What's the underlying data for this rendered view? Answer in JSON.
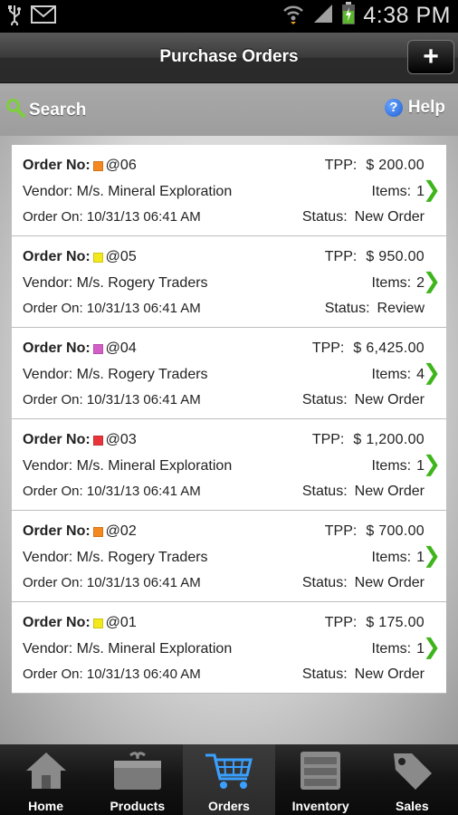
{
  "status_bar": {
    "time": "4:38 PM"
  },
  "header": {
    "title": "Purchase Orders",
    "add_label": "+"
  },
  "toolbar": {
    "search_label": "Search",
    "help_label": "Help"
  },
  "labels": {
    "order_no": "Order No:",
    "vendor": "Vendor:",
    "order_on": "Order On:",
    "tpp": "TPP:",
    "items": "Items:",
    "status": "Status:"
  },
  "orders": [
    {
      "color": "#f5891f",
      "number": "@06",
      "vendor": "M/s. Mineral Exploration",
      "date": "10/31/13 06:41 AM",
      "amount": "$ 200.00",
      "items": "1",
      "status": "New Order"
    },
    {
      "color": "#f2e81c",
      "number": "@05",
      "vendor": "M/s. Rogery Traders",
      "date": "10/31/13 06:41 AM",
      "amount": "$ 950.00",
      "items": "2",
      "status": "Review"
    },
    {
      "color": "#d35fc6",
      "number": "@04",
      "vendor": "M/s. Rogery Traders",
      "date": "10/31/13 06:41 AM",
      "amount": "$ 6,425.00",
      "items": "4",
      "status": "New Order"
    },
    {
      "color": "#e8353a",
      "number": "@03",
      "vendor": "M/s. Mineral Exploration",
      "date": "10/31/13 06:41 AM",
      "amount": "$ 1,200.00",
      "items": "1",
      "status": "New Order"
    },
    {
      "color": "#f5891f",
      "number": "@02",
      "vendor": "M/s. Rogery Traders",
      "date": "10/31/13 06:41 AM",
      "amount": "$ 700.00",
      "items": "1",
      "status": "New Order"
    },
    {
      "color": "#f2e81c",
      "number": "@01",
      "vendor": "M/s. Mineral Exploration",
      "date": "10/31/13 06:40 AM",
      "amount": "$ 175.00",
      "items": "1",
      "status": "New Order"
    }
  ],
  "tabs": [
    {
      "label": "Home",
      "icon": "home-icon"
    },
    {
      "label": "Products",
      "icon": "products-box-icon"
    },
    {
      "label": "Orders",
      "icon": "cart-icon",
      "active": true
    },
    {
      "label": "Inventory",
      "icon": "inventory-icon"
    },
    {
      "label": "Sales",
      "icon": "price-tag-icon"
    }
  ]
}
